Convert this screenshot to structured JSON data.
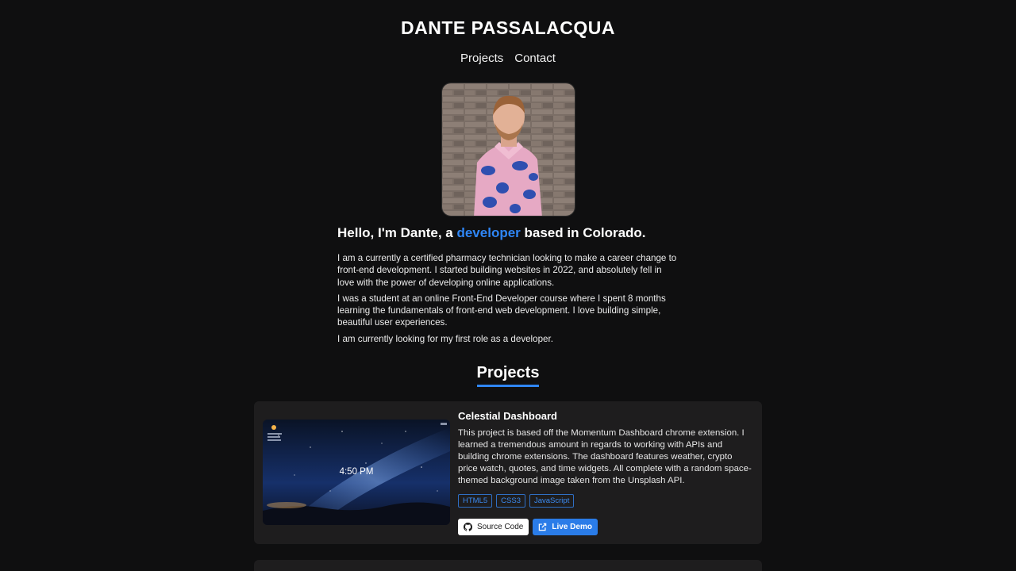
{
  "header": {
    "title": "DANTE PASSALACQUA"
  },
  "nav": {
    "items": [
      {
        "label": "Projects"
      },
      {
        "label": "Contact"
      }
    ]
  },
  "intro": {
    "greeting_prefix": "Hello, I'm Dante, a ",
    "greeting_accent": "developer",
    "greeting_suffix": " based in Colorado.",
    "paragraphs": [
      "I am a currently a certified pharmacy technician looking to make a career change to front-end development. I started building websites in 2022, and absolutely fell in love with the power of developing online applications.",
      "I was a student at an online Front-End Developer course where I spent 8 months learning the fundamentals of front-end web development. I love building simple, beautiful user experiences.",
      "I am currently looking for my first role as a developer."
    ]
  },
  "projects": {
    "title": "Projects",
    "items": [
      {
        "title": "Celestial Dashboard",
        "thumb_time": "4:50 PM",
        "description": "This project is based off the Momentum Dashboard chrome extension. I learned a tremendous amount in regards to working with APIs and building chrome extensions. The dashboard features weather, crypto price watch, quotes, and time widgets. All complete with a random space-themed background image taken from the Unsplash API.",
        "tags": [
          "HTML5",
          "CSS3",
          "JavaScript"
        ],
        "source_label": "Source Code",
        "demo_label": "Live Demo"
      }
    ]
  },
  "colors": {
    "accent": "#2f86f6",
    "background": "#0f0f10",
    "card": "#1e1d1e"
  },
  "icons": {
    "source": "github-icon",
    "demo": "external-link-icon"
  }
}
